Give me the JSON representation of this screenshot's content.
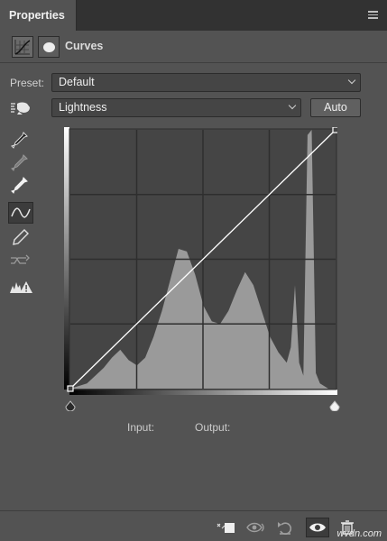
{
  "panel": {
    "tab_label": "Properties",
    "menu_icon": "panel-menu-icon"
  },
  "adjustment": {
    "title": "Curves",
    "icons": [
      "curves-adjustment-icon",
      "layer-mask-icon"
    ]
  },
  "preset": {
    "label": "Preset:",
    "value": "Default"
  },
  "channel": {
    "value": "Lightness",
    "auto_label": "Auto",
    "hand_icon": "on-image-adjust-icon"
  },
  "tools": [
    "sample-black-point-icon",
    "sample-gray-point-icon",
    "sample-white-point-icon",
    "edit-points-curve-icon",
    "pencil-draw-icon",
    "smooth-curve-icon",
    "clipping-warning-icon"
  ],
  "readout": {
    "input_label": "Input:",
    "output_label": "Output:"
  },
  "footer_icons": [
    "clip-to-layer-icon",
    "view-previous-state-icon",
    "reset-icon",
    "visibility-eye-icon",
    "trash-icon"
  ],
  "watermark": "wvdn.com",
  "colors": {
    "panel_bg": "#535353",
    "graph_bg": "#454545",
    "histogram": "#9a9a9a",
    "grid": "#2e2e2e",
    "curve": "#ffffff"
  },
  "chart_data": {
    "type": "area",
    "x": [
      0,
      8,
      16,
      24,
      32,
      40,
      48,
      56,
      64,
      72,
      80,
      88,
      96,
      104,
      112,
      120,
      128,
      136,
      144,
      152,
      160,
      168,
      176,
      184,
      192,
      200,
      208,
      212,
      216,
      220,
      224,
      228,
      232,
      236,
      240,
      244,
      248,
      255
    ],
    "values": [
      0.0,
      0.01,
      0.02,
      0.05,
      0.08,
      0.12,
      0.15,
      0.11,
      0.09,
      0.12,
      0.2,
      0.3,
      0.42,
      0.54,
      0.53,
      0.44,
      0.32,
      0.26,
      0.25,
      0.3,
      0.38,
      0.45,
      0.4,
      0.3,
      0.2,
      0.14,
      0.1,
      0.16,
      0.4,
      0.1,
      0.05,
      0.98,
      1.0,
      0.06,
      0.02,
      0.01,
      0.0,
      0.0
    ],
    "curve_points": [
      [
        0,
        0
      ],
      [
        255,
        255
      ]
    ],
    "xlim": [
      0,
      255
    ],
    "ylim": [
      0,
      255
    ],
    "grid": "4x4 quarter tones"
  }
}
